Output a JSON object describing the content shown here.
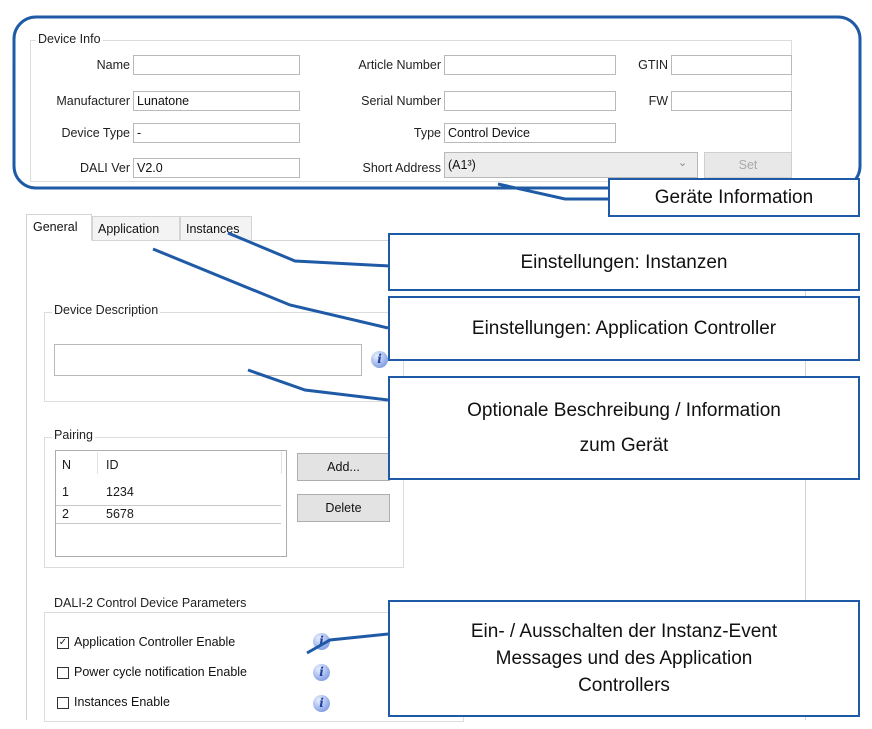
{
  "device_info": {
    "group_label": "Device Info",
    "fields": {
      "name": {
        "label": "Name",
        "value": ""
      },
      "manufacturer": {
        "label": "Manufacturer",
        "value": "Lunatone"
      },
      "device_type": {
        "label": "Device Type",
        "value": "-"
      },
      "dali_ver": {
        "label": "DALI Ver",
        "value": "V2.0"
      },
      "article_number": {
        "label": "Article Number",
        "value": ""
      },
      "serial_number": {
        "label": "Serial Number",
        "value": ""
      },
      "type": {
        "label": "Type",
        "value": "Control Device"
      },
      "short_address": {
        "label": "Short Address",
        "value": "(A1³)"
      },
      "gtin": {
        "label": "GTIN",
        "value": ""
      },
      "fw": {
        "label": "FW",
        "value": ""
      }
    },
    "set_button": "Set"
  },
  "tabs": [
    "General",
    "Application",
    "Instances"
  ],
  "device_description": {
    "label": "Device Description",
    "value": ""
  },
  "pairing": {
    "label": "Pairing",
    "columns": [
      "N",
      "ID"
    ],
    "rows": [
      [
        "1",
        "1234"
      ],
      [
        "2",
        "5678"
      ]
    ],
    "add_button": "Add...",
    "delete_button": "Delete"
  },
  "parameters": {
    "label": "DALI-2 Control Device Parameters",
    "items": [
      {
        "label": "Application Controller Enable",
        "checked": true
      },
      {
        "label": "Power cycle notification Enable",
        "checked": false
      },
      {
        "label": "Instances Enable",
        "checked": false
      }
    ]
  },
  "callouts": {
    "geraete_info": "Geräte Information",
    "instanzen": "Einstellungen: Instanzen",
    "application": "Einstellungen: Application Controller",
    "beschreibung_1": "Optionale Beschreibung / Information",
    "beschreibung_2": "zum Gerät",
    "event_1": "Ein- / Ausschalten der Instanz-Event",
    "event_2": "Messages und des Application",
    "event_3": "Controllers"
  },
  "colors": {
    "accent": "#1f5aa6",
    "info_icon": "#5a7cc8"
  },
  "icons": {
    "info": "info-icon",
    "dropdown": "chevron-down-icon",
    "check": "checkmark-icon"
  }
}
